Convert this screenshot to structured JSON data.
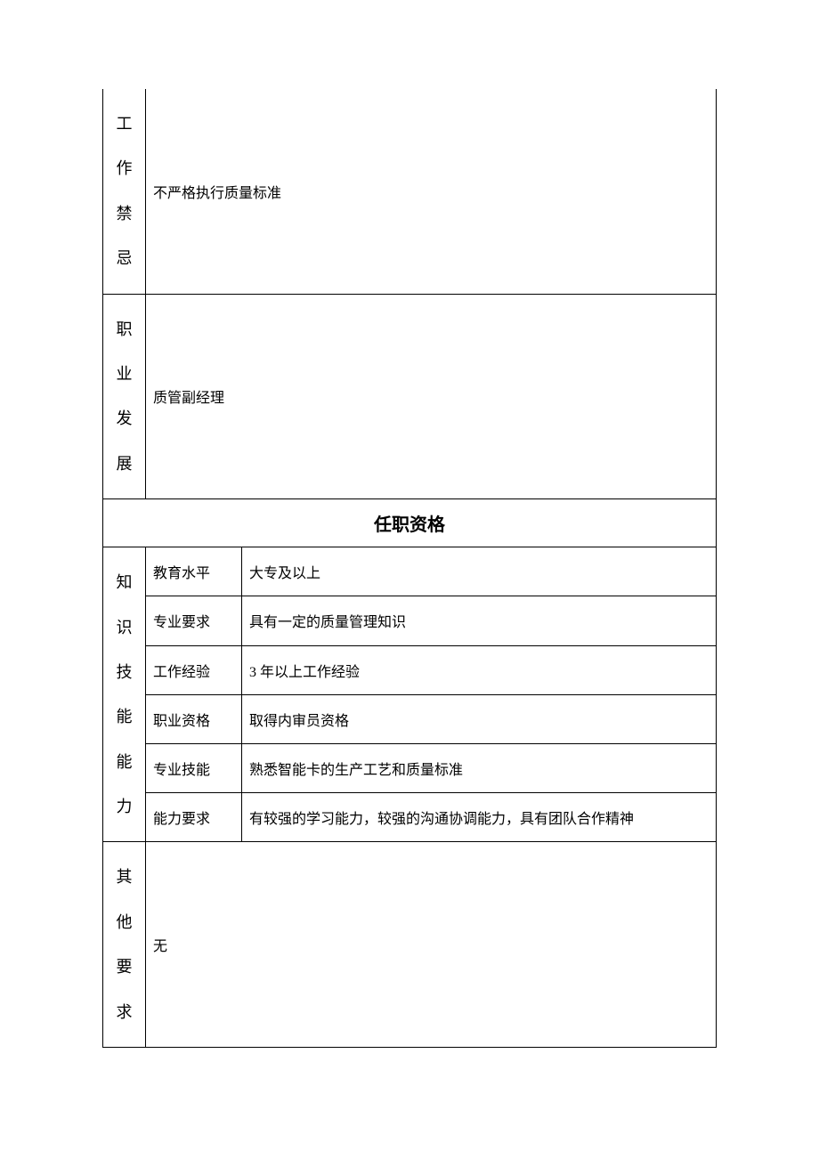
{
  "rows": {
    "work_prohibition": {
      "label": "工作禁忌",
      "value": "不严格执行质量标准"
    },
    "career_development": {
      "label": "职业发展",
      "value": "质管副经理"
    }
  },
  "section_header": "任职资格",
  "qualification": {
    "group_label": "知识技能能力",
    "education": {
      "label": "教育水平",
      "value": "大专及以上"
    },
    "major": {
      "label": "专业要求",
      "value": "具有一定的质量管理知识"
    },
    "experience": {
      "label": "工作经验",
      "value": "3 年以上工作经验"
    },
    "certificate": {
      "label": "职业资格",
      "value": "取得内审员资格"
    },
    "skill": {
      "label": "专业技能",
      "value": "熟悉智能卡的生产工艺和质量标准"
    },
    "ability": {
      "label": "能力要求",
      "value": "有较强的学习能力，较强的沟通协调能力，具有团队合作精神"
    }
  },
  "other": {
    "label": "其他要求",
    "value": "无"
  }
}
